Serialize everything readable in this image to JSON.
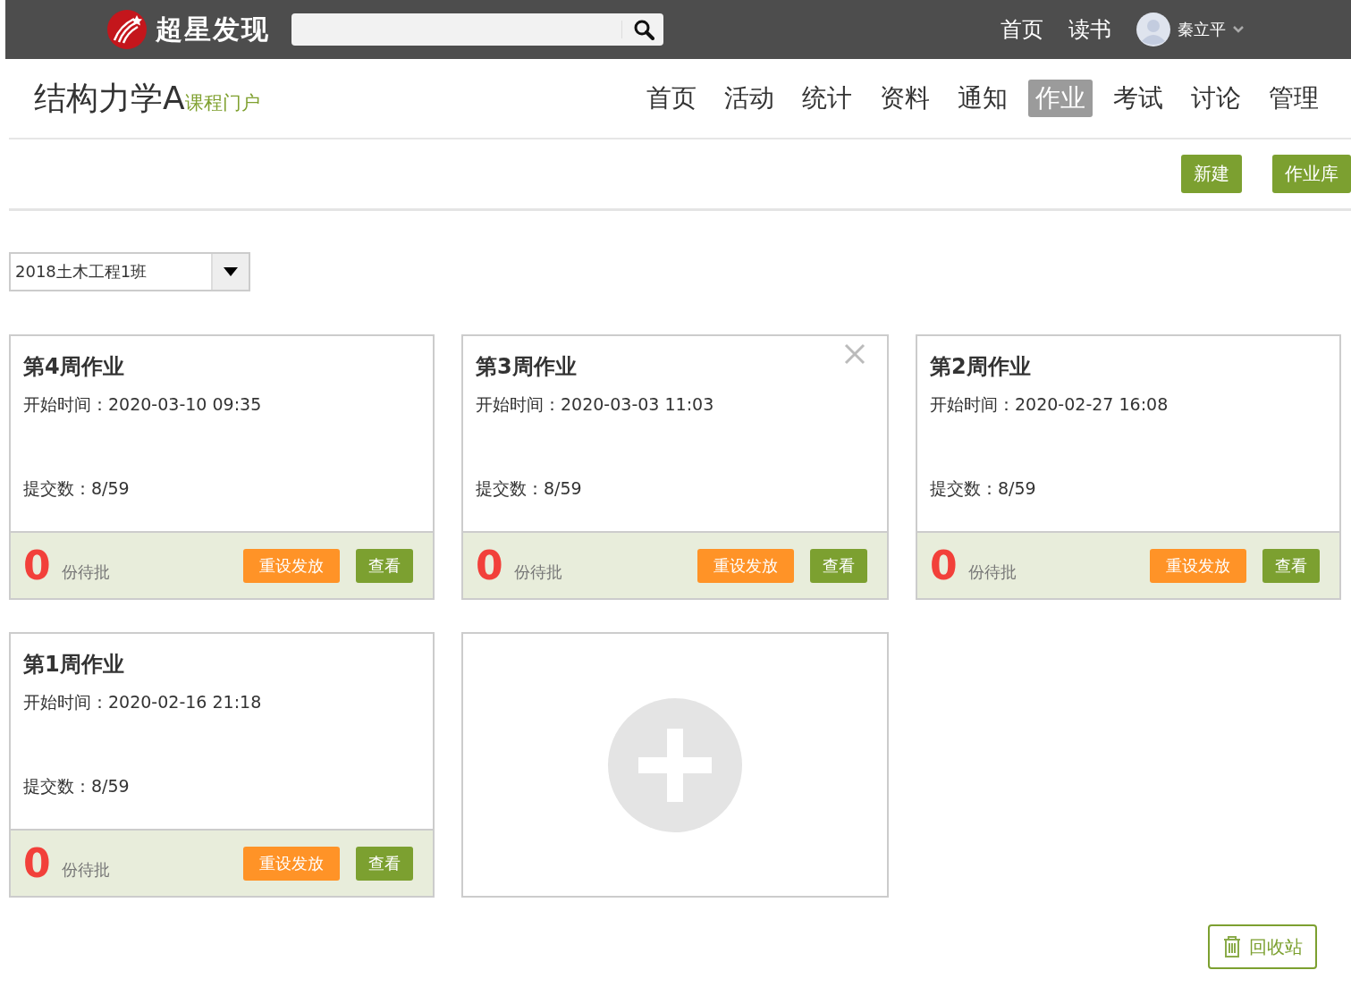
{
  "top_bar": {
    "logo_text": "超星发现",
    "links": [
      "首页",
      "读书"
    ],
    "user_name": "秦立平"
  },
  "course": {
    "title": "结构力学A",
    "subtitle": "课程门户"
  },
  "nav_tabs": [
    {
      "label": "首页",
      "selected": false
    },
    {
      "label": "活动",
      "selected": false
    },
    {
      "label": "统计",
      "selected": false
    },
    {
      "label": "资料",
      "selected": false
    },
    {
      "label": "通知",
      "selected": false
    },
    {
      "label": "作业",
      "selected": true
    },
    {
      "label": "考试",
      "selected": false
    },
    {
      "label": "讨论",
      "selected": false
    },
    {
      "label": "管理",
      "selected": false
    }
  ],
  "actions": [
    "新建",
    "作业库"
  ],
  "class_select": {
    "value": "2018土木工程1班"
  },
  "assignments": [
    {
      "title": "第4周作业",
      "start_label": "开始时间：",
      "start_time": "2020-03-10 09:35",
      "submitted_label": "提交数：",
      "submitted": "8/59",
      "pending_count": "0",
      "pending_label": "份待批",
      "reset_button": "重设发放",
      "view_button": "查看",
      "close_visible": false
    },
    {
      "title": "第3周作业",
      "start_label": "开始时间：",
      "start_time": "2020-03-03 11:03",
      "submitted_label": "提交数：",
      "submitted": "8/59",
      "pending_count": "0",
      "pending_label": "份待批",
      "reset_button": "重设发放",
      "view_button": "查看",
      "close_visible": true
    },
    {
      "title": "第2周作业",
      "start_label": "开始时间：",
      "start_time": "2020-02-27 16:08",
      "submitted_label": "提交数：",
      "submitted": "8/59",
      "pending_count": "0",
      "pending_label": "份待批",
      "reset_button": "重设发放",
      "view_button": "查看",
      "close_visible": false
    },
    {
      "title": "第1周作业",
      "start_label": "开始时间：",
      "start_time": "2020-02-16 21:18",
      "submitted_label": "提交数：",
      "submitted": "8/59",
      "pending_count": "0",
      "pending_label": "份待批",
      "reset_button": "重设发放",
      "view_button": "查看",
      "close_visible": false
    }
  ],
  "recycle_button": "回收站"
}
